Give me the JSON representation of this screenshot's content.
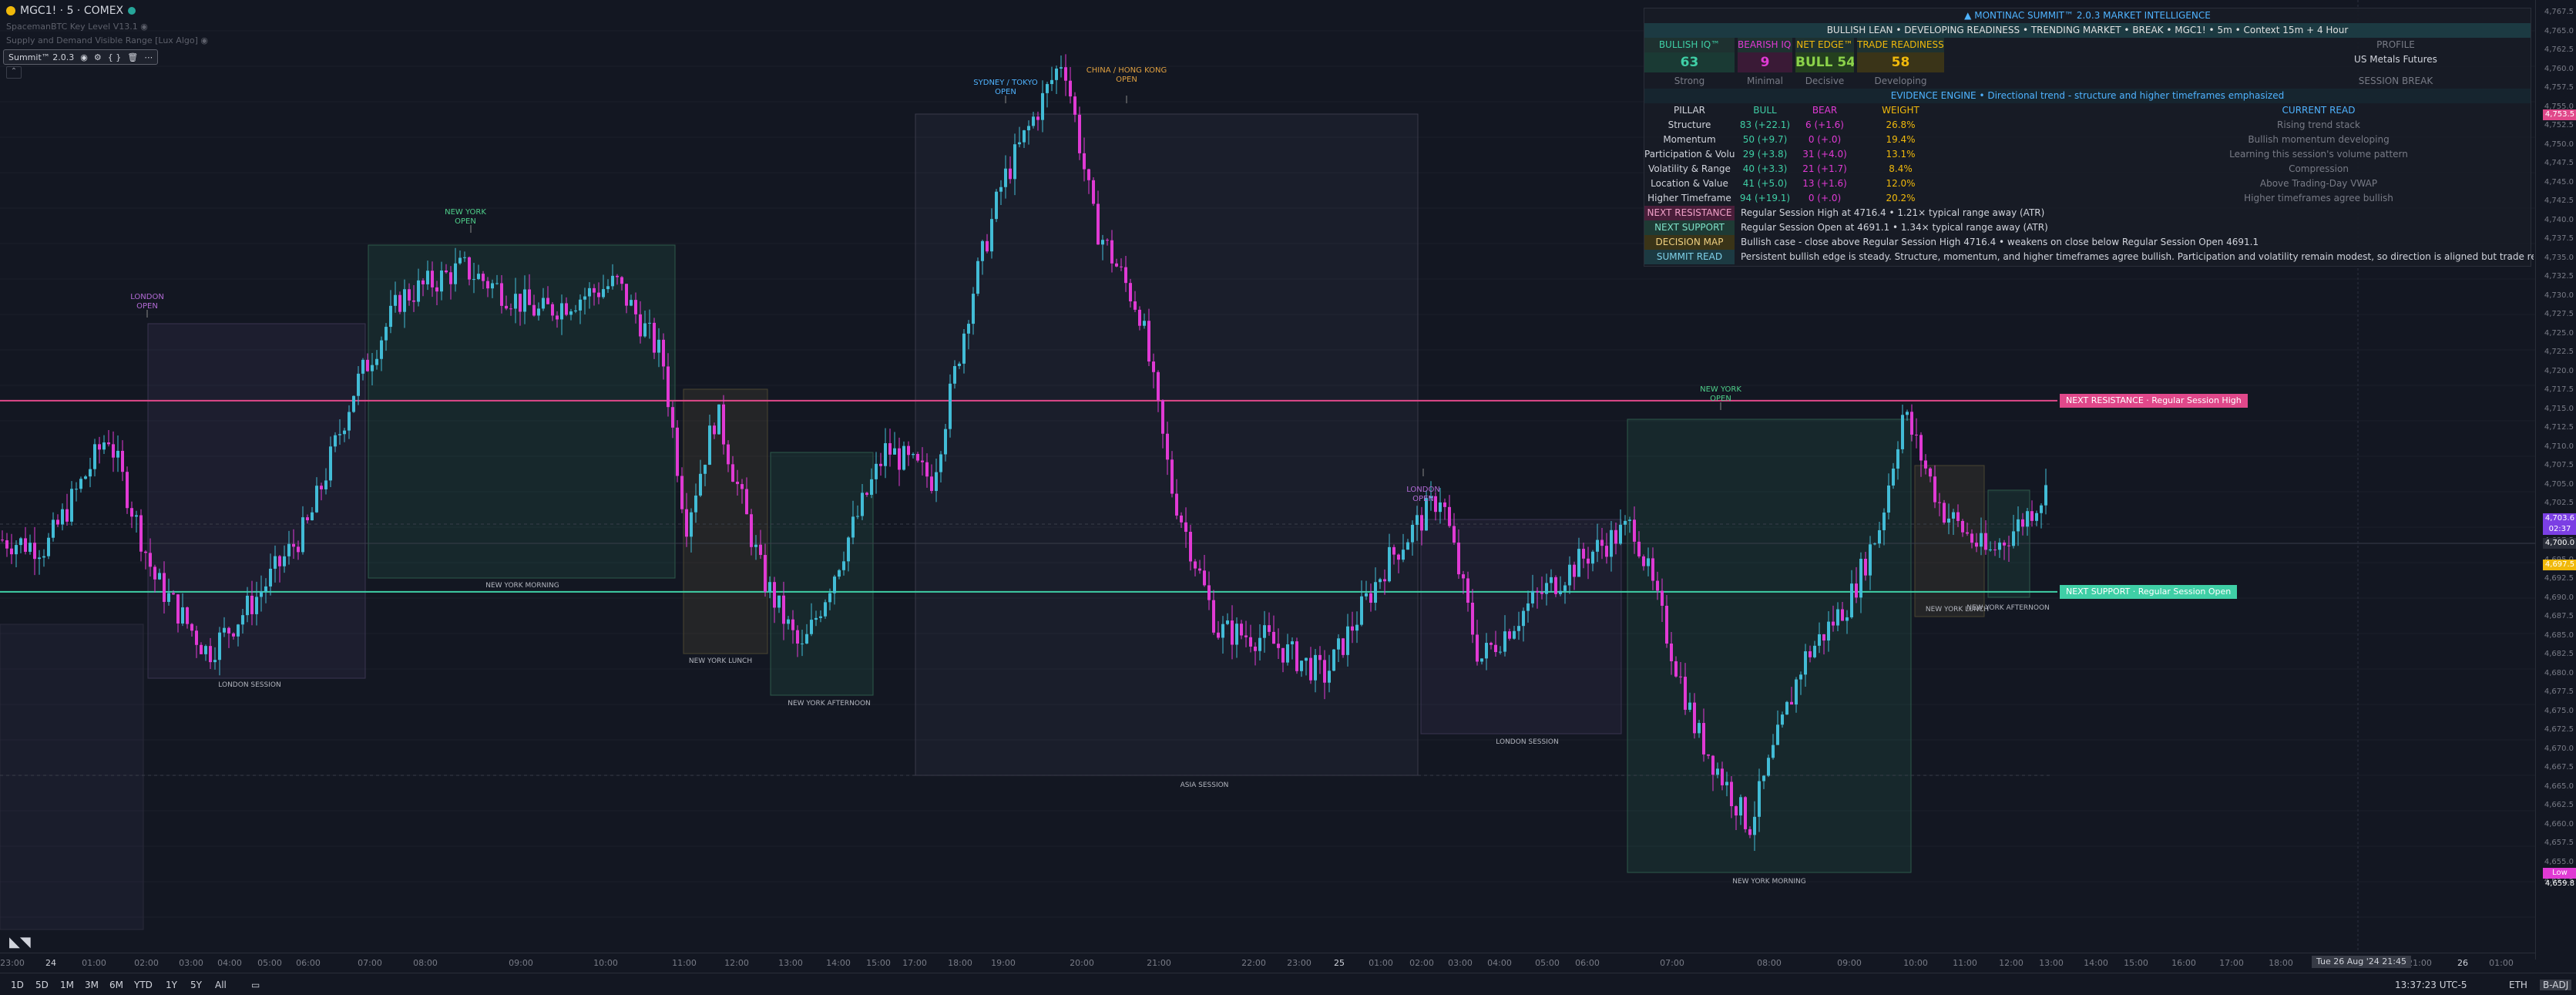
{
  "header": {
    "symbol_title": "MGC1! · 5 · COMEX",
    "indicator_line_1": "SpacemanBTC Key Level V13.1",
    "indicator_line_2": "Supply and Demand Visible Range [Lux Algo]",
    "study_name": "Summit™ 2.0.3",
    "collapse_glyph": "⌃"
  },
  "panel": {
    "title": "▲ MONTINAC  SUMMIT™ 2.0.3  MARKET INTELLIGENCE",
    "status_line": "BULLISH LEAN  •  DEVELOPING READINESS  •  TRENDING MARKET  •  BREAK  •  MGC1!  •  5m  •  Context 15m + 4 Hour",
    "score_headers": [
      "BULLISH IQ™",
      "BEARISH IQ™",
      "NET EDGE™",
      "TRADE READINESS™"
    ],
    "score_values": [
      "63",
      "9",
      "BULL 54",
      "58"
    ],
    "score_tags": [
      "Strong",
      "Minimal",
      "Decisive",
      "Developing"
    ],
    "profile_label": "PROFILE",
    "profile_value": "US Metals Futures",
    "session_label": "SESSION BREAK",
    "evidence_line": "EVIDENCE ENGINE  •  Directional trend - structure and higher timeframes emphasized",
    "pillar_headers": [
      "PILLAR",
      "BULL",
      "BEAR",
      "WEIGHT",
      "CURRENT READ"
    ],
    "pillars": [
      {
        "name": "Structure",
        "bull": "83 (+22.1)",
        "bear": "6 (+1.6)",
        "weight": "26.8%",
        "read": "Rising trend stack"
      },
      {
        "name": "Momentum",
        "bull": "50 (+9.7)",
        "bear": "0 (+.0)",
        "weight": "19.4%",
        "read": "Bullish momentum developing"
      },
      {
        "name": "Participation & Volume",
        "bull": "29 (+3.8)",
        "bear": "31 (+4.0)",
        "weight": "13.1%",
        "read": "Learning this session's volume pattern"
      },
      {
        "name": "Volatility & Range",
        "bull": "40 (+3.3)",
        "bear": "21 (+1.7)",
        "weight": "8.4%",
        "read": "Compression"
      },
      {
        "name": "Location & Value",
        "bull": "41 (+5.0)",
        "bear": "13 (+1.6)",
        "weight": "12.0%",
        "read": "Above Trading-Day VWAP"
      },
      {
        "name": "Higher Timeframe",
        "bull": "94 (+19.1)",
        "bear": "0 (+.0)",
        "weight": "20.2%",
        "read": "Higher timeframes agree bullish"
      }
    ],
    "notes": [
      {
        "key": "NEXT RESISTANCE",
        "text": "Regular Session High at 4716.4  •  1.21× typical range away (ATR)"
      },
      {
        "key": "NEXT SUPPORT",
        "text": "Regular Session Open at 4691.1  •  1.34× typical range away (ATR)"
      },
      {
        "key": "DECISION MAP",
        "text": "Bullish case - close above Regular Session High 4716.4  •  weakens on close below Regular Session Open 4691.1"
      },
      {
        "key": "SUMMIT READ",
        "text": "Persistent bullish edge is steady. Structure, momentum, and higher timeframes agree bullish. Participation and volatility remain modest, so direction is aligned but trade readiness is still developing."
      }
    ]
  },
  "levels": {
    "resistance_label": "NEXT RESISTANCE · Regular Session High",
    "support_label": "NEXT SUPPORT · Regular Session Open",
    "resistance_price": 4716.4,
    "support_price": 4691.1
  },
  "price_axis": {
    "ticks": [
      "4,767.5",
      "4,765.0",
      "4,762.5",
      "4,760.0",
      "4,757.5",
      "4,755.0",
      "4,752.5",
      "4,750.0",
      "4,747.5",
      "4,745.0",
      "4,742.5",
      "4,740.0",
      "4,737.5",
      "4,735.0",
      "4,732.5",
      "4,730.0",
      "4,727.5",
      "4,725.0",
      "4,722.5",
      "4,720.0",
      "4,717.5",
      "4,715.0",
      "4,712.5",
      "4,710.0",
      "4,707.5",
      "4,705.0",
      "4,702.5",
      "4,700.0",
      "4,697.5",
      "4,695.0",
      "4,692.5",
      "4,690.0",
      "4,687.5",
      "4,685.0",
      "4,682.5",
      "4,680.0",
      "4,677.5",
      "4,675.0",
      "4,672.5",
      "4,670.0",
      "4,667.5",
      "4,665.0",
      "4,662.5",
      "4,660.0",
      "4,657.5",
      "4,655.0",
      "4,652.5"
    ],
    "tag_top": "4,753.5",
    "tag_last_1": "4,703.6",
    "tag_last_2": "02:37",
    "tag_mid": "4,700.0",
    "tag_yellow": "4,697.5",
    "tag_low": "Low 4,659.8",
    "ymin": 4651.5,
    "ymax": 4768.0
  },
  "time_axis": {
    "ticks": [
      "23:00",
      "24",
      "01:00",
      "02:00",
      "03:00",
      "04:00",
      "05:00",
      "06:00",
      "07:00",
      "08:00",
      "09:00",
      "10:00",
      "11:00",
      "12:00",
      "13:00",
      "14:00",
      "15:00",
      "17:00",
      "18:00",
      "19:00",
      "20:00",
      "21:00",
      "22:00",
      "23:00",
      "25",
      "01:00",
      "02:00",
      "03:00",
      "04:00",
      "05:00",
      "06:00",
      "07:00",
      "08:00",
      "09:00",
      "10:00",
      "11:00",
      "12:00",
      "13:00",
      "14:00",
      "15:00",
      "16:00",
      "17:00",
      "18:00",
      "19:00",
      "20:00",
      "21:00",
      "26",
      "01:00"
    ],
    "cursor_label": "Tue 26 Aug '24  21:45"
  },
  "sessions": {
    "labels": [
      "LONDON SESSION",
      "NEW YORK MORNING",
      "NEW YORK LUNCH",
      "NEW YORK AFTERNOON",
      "ASIA SESSION",
      "LONDON SESSION",
      "NEW YORK MORNING",
      "NEW YORK LUNCH",
      "NEW YORK AFTERNOON"
    ],
    "opens": [
      "LONDON\nOPEN",
      "NEW YORK\nOPEN",
      "SYDNEY / TOKYO\nOPEN",
      "CHINA / HONG KONG\nOPEN",
      "LONDON\nOPEN",
      "NEW YORK\nOPEN"
    ]
  },
  "bottom": {
    "timeframes": [
      "1D",
      "5D",
      "1M",
      "3M",
      "6M",
      "YTD",
      "1Y",
      "5Y",
      "All"
    ],
    "clock": "13:37:23 UTC-5",
    "session_mode": "ETH",
    "adj_label": "B-ADJ"
  },
  "colors": {
    "bull": "#42bcd6",
    "bear": "#e03ad4",
    "resistance": "#e0488a",
    "support": "#3fcfa6",
    "panel_accent": "#4fb3ff"
  }
}
